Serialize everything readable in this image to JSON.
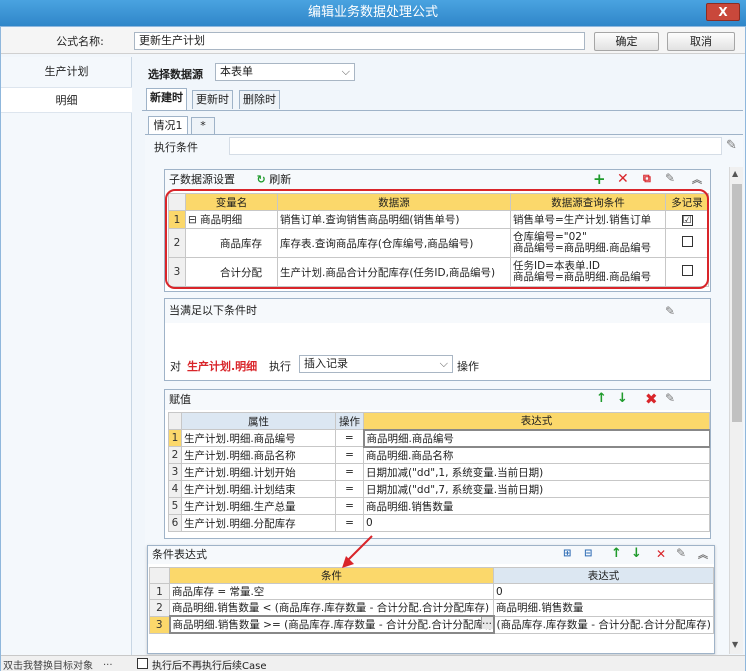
{
  "window": {
    "title": "编辑业务数据处理公式",
    "close_label": "X"
  },
  "formula": {
    "name_label": "公式名称:",
    "name_value": "更新生产计划",
    "ok_label": "确定",
    "cancel_label": "取消"
  },
  "sidebar": {
    "items": [
      {
        "label": "生产计划"
      },
      {
        "label": "明细"
      }
    ]
  },
  "datasource": {
    "label": "选择数据源",
    "value": "本表单",
    "tabs": [
      "新建时",
      "更新时",
      "删除时"
    ]
  },
  "situation": {
    "tabs": [
      "情况1",
      "*"
    ],
    "condition_label": "执行条件"
  },
  "subsource": {
    "title": "子数据源设置",
    "refresh_label": "刷新",
    "columns": [
      "变量名",
      "数据源",
      "数据源查询条件",
      "多记录"
    ],
    "rows": [
      {
        "num": "1",
        "expander": "⊟",
        "name": "商品明细",
        "source": "销售订单.查询销售商品明细(销售单号)",
        "cond1": "销售单号=生产计划.销售订单",
        "cond2": "",
        "multi": "☑"
      },
      {
        "num": "2",
        "expander": "",
        "name": "商品库存",
        "source": "库存表.查询商品库存(仓库编号,商品编号)",
        "cond1": "仓库编号=\"02\"",
        "cond2": "商品编号=商品明细.商品编号",
        "multi": ""
      },
      {
        "num": "3",
        "expander": "",
        "name": "合计分配",
        "source": "生产计划.商品合计分配库存(任务ID,商品编号)",
        "cond1": "任务ID=本表单.ID",
        "cond2": "商品编号=商品明细.商品编号",
        "multi": ""
      }
    ]
  },
  "when": {
    "title": "当满足以下条件时",
    "to_label": "对",
    "target": "生产计划.明细",
    "exec_label": "执行",
    "action": "插入记录",
    "op_label": "操作"
  },
  "assign": {
    "title": "赋值",
    "columns": [
      "属性",
      "操作",
      "表达式"
    ],
    "rows": [
      {
        "num": "1",
        "attr": "生产计划.明细.商品编号",
        "op": "=",
        "expr": "商品明细.商品编号"
      },
      {
        "num": "2",
        "attr": "生产计划.明细.商品名称",
        "op": "=",
        "expr": "商品明细.商品名称"
      },
      {
        "num": "3",
        "attr": "生产计划.明细.计划开始",
        "op": "=",
        "expr": "日期加减(\"dd\",1, 系统变量.当前日期)"
      },
      {
        "num": "4",
        "attr": "生产计划.明细.计划结束",
        "op": "=",
        "expr": "日期加减(\"dd\",7, 系统变量.当前日期)"
      },
      {
        "num": "5",
        "attr": "生产计划.明细.生产总量",
        "op": "=",
        "expr": "商品明细.销售数量"
      },
      {
        "num": "6",
        "attr": "生产计划.明细.分配库存",
        "op": "=",
        "expr": "0"
      }
    ]
  },
  "condexpr": {
    "title": "条件表达式",
    "columns": [
      "条件",
      "表达式"
    ],
    "rows": [
      {
        "num": "1",
        "cond": "商品库存 = 常量.空",
        "expr": "0"
      },
      {
        "num": "2",
        "cond": "商品明细.销售数量 < (商品库存.库存数量 - 合计分配.合计分配库存)",
        "expr": "商品明细.销售数量"
      },
      {
        "num": "3",
        "cond": "商品明细.销售数量 >= (商品库存.库存数量 - 合计分配.合计分配库存)",
        "expr": "(商品库存.库存数量 - 合计分配.合计分配库存)"
      }
    ]
  },
  "footer": {
    "hint": "双击我替换目标对象",
    "more": "...",
    "checkbox_label": "执行后不再执行后续Case"
  },
  "colors": {
    "title_bar": "#3a95d6",
    "header_yellow": "#fbd86b",
    "highlight_red": "#d9252a",
    "accent_green": "#1f9b2c"
  }
}
